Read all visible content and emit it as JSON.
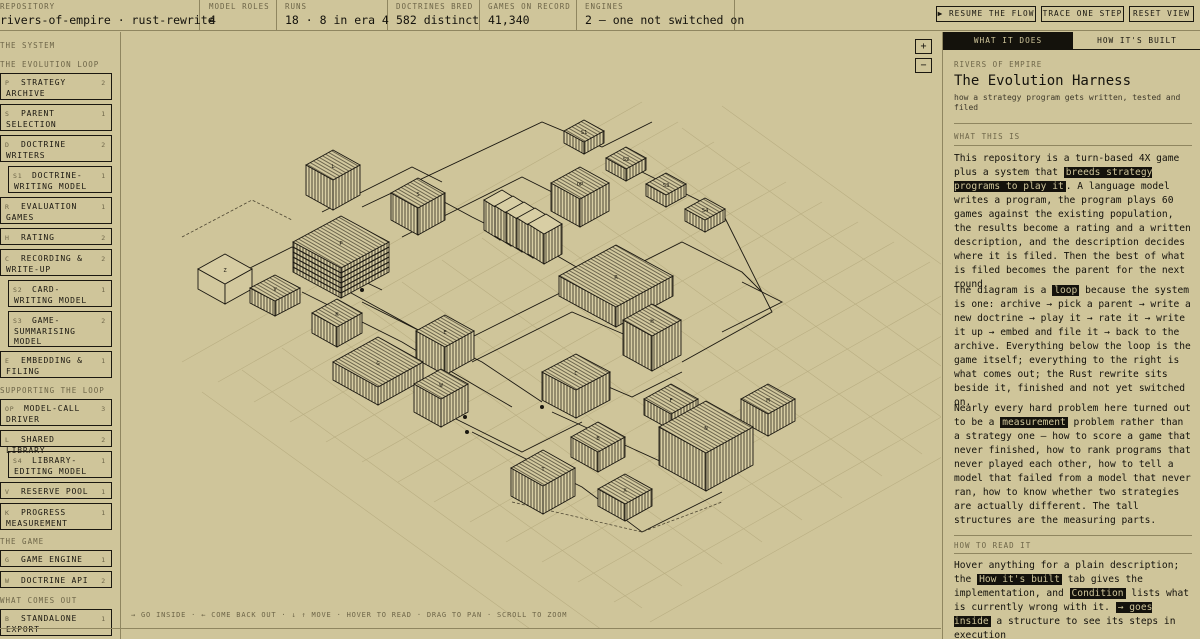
{
  "stats": [
    {
      "label": "REPOSITORY",
      "value": "rivers-of-empire · rust-rewrite"
    },
    {
      "label": "MODEL ROLES",
      "value": "4"
    },
    {
      "label": "RUNS",
      "value": "18 · 8 in era 4"
    },
    {
      "label": "DOCTRINES BRED",
      "value": "582 distinct"
    },
    {
      "label": "GAMES ON RECORD",
      "value": "41,340"
    },
    {
      "label": "ENGINES",
      "value": "2 — one not switched on"
    }
  ],
  "toolbar": {
    "resume": "▶ RESUME THE FLOW",
    "trace": "TRACE ONE STEP",
    "reset": "RESET VIEW"
  },
  "sidebar": {
    "system_title": "THE SYSTEM",
    "sections": [
      {
        "title": "THE EVOLUTION LOOP",
        "items": [
          {
            "code": "P",
            "label": "STRATEGY ARCHIVE",
            "count": "2"
          },
          {
            "code": "S",
            "label": "PARENT SELECTION",
            "count": "1"
          },
          {
            "code": "D",
            "label": "DOCTRINE WRITERS",
            "count": "2"
          },
          {
            "code": "S1",
            "label": "DOCTRINE-WRITING MODEL",
            "count": "1"
          },
          {
            "code": "R",
            "label": "EVALUATION GAMES",
            "count": "1"
          },
          {
            "code": "H",
            "label": "RATING",
            "count": "2"
          },
          {
            "code": "C",
            "label": "RECORDING & WRITE-UP",
            "count": "2"
          },
          {
            "code": "S2",
            "label": "CARD-WRITING MODEL",
            "count": "1"
          },
          {
            "code": "S3",
            "label": "GAME-SUMMARISING MODEL",
            "count": "2"
          },
          {
            "code": "E",
            "label": "EMBEDDING & FILING",
            "count": "1"
          }
        ]
      },
      {
        "title": "SUPPORTING THE LOOP",
        "items": [
          {
            "code": "OP",
            "label": "MODEL-CALL DRIVER",
            "count": "3"
          },
          {
            "code": "L",
            "label": "SHARED LIBRARY",
            "count": "2"
          },
          {
            "code": "S4",
            "label": "LIBRARY-EDITING MODEL",
            "count": "1"
          },
          {
            "code": "V",
            "label": "RESERVE POOL",
            "count": "1"
          },
          {
            "code": "K",
            "label": "PROGRESS MEASUREMENT",
            "count": "1"
          }
        ]
      },
      {
        "title": "THE GAME",
        "items": [
          {
            "code": "G",
            "label": "GAME ENGINE",
            "count": "1"
          },
          {
            "code": "W",
            "label": "DOCTRINE API",
            "count": "2"
          }
        ]
      },
      {
        "title": "WHAT COMES OUT",
        "items": [
          {
            "code": "B",
            "label": "STANDALONE EXPORT",
            "count": "1"
          }
        ]
      }
    ]
  },
  "diagram": {
    "zoom_in": "+",
    "zoom_out": "−",
    "blocks": [
      "L",
      "S",
      "P",
      "Z",
      "V",
      "K",
      "E",
      "G",
      "W",
      "S1",
      "S2",
      "S3",
      "S4",
      "OP",
      "R",
      "H",
      "C",
      "F",
      "M",
      "N",
      "B",
      "T",
      "X"
    ],
    "hints": "→ GO INSIDE · ← COME BACK OUT · ↓ ↑ MOVE · HOVER TO READ · DRAG TO PAN · SCROLL TO ZOOM"
  },
  "panel": {
    "tabs": [
      "WHAT IT DOES",
      "HOW IT'S BUILT"
    ],
    "kicker": "RIVERS OF EMPIRE",
    "title": "The Evolution Harness",
    "subtitle": "how a strategy program gets written, tested and filed",
    "section1": "WHAT THIS IS",
    "p1": [
      {
        "t": "This repository is a turn-based 4X game plus a system that "
      },
      {
        "t": "breeds strategy programs to play it",
        "hl": true
      },
      {
        "t": ". A language model writes a program, the program plays 60 games against the existing population, the results become a rating and a written description, and the description decides where it is filed. Then the best of what is filed becomes the parent for the next round."
      }
    ],
    "p2": [
      {
        "t": "The diagram is a "
      },
      {
        "t": "loop",
        "hl": true
      },
      {
        "t": " because the system is one: archive → pick a parent → write a new doctrine → play it → rate it → write it up → embed and file it → back to the archive. Everything below the loop is the game itself; everything to the right is what comes out; the Rust rewrite sits beside it, finished and not yet switched on."
      }
    ],
    "p3": [
      {
        "t": "Nearly every hard problem here turned out to be a "
      },
      {
        "t": "measurement",
        "hl": true
      },
      {
        "t": " problem rather than a strategy one — how to score a game that never finished, how to rank programs that never played each other, how to tell a model that failed from a model that never ran, how to know whether two strategies are actually different. The tall structures are the measuring parts."
      }
    ],
    "section2": "HOW TO READ IT",
    "p4": [
      {
        "t": "Hover anything for a plain description; the "
      },
      {
        "t": "How it's built",
        "hl": true
      },
      {
        "t": " tab gives the implementation, and "
      },
      {
        "t": "Condition",
        "hl": true
      },
      {
        "t": " lists what is currently wrong with it. "
      },
      {
        "t": "→ goes inside",
        "hl": true
      },
      {
        "t": " a structure to see its steps in execution"
      }
    ]
  }
}
